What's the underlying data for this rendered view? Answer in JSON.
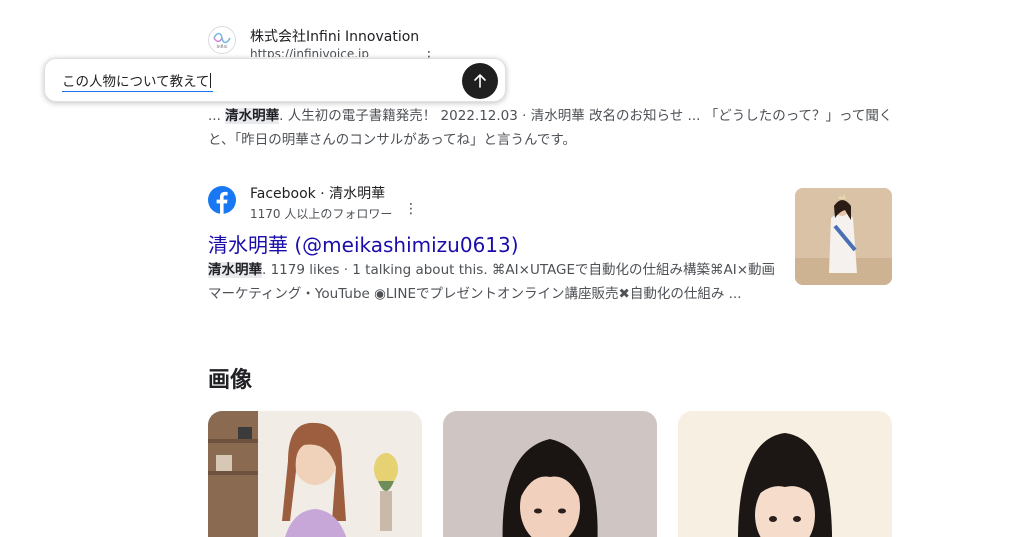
{
  "result1": {
    "site_name": "株式会社Infini Innovation",
    "site_url": "https://infinivoice.jp",
    "favicon_icon": "infini-logo-icon",
    "menu_icon": "more-vert-icon",
    "snippet_prefix": "... ",
    "snippet_highlight": "清水明華",
    "snippet_rest": ". 人生初の電子書籍発売！ 2022.12.03 · 清水明華 改名のお知らせ ... 「どうしたのって？」って聞くと、「昨日の明華さんのコンサルがあってね」と言うんです。"
  },
  "prompt": {
    "text": "この人物について教えて",
    "send_icon": "arrow-up-icon",
    "send_button_color": "#1f1f1f"
  },
  "result2": {
    "icon": "facebook-icon",
    "icon_color": "#1877f2",
    "source": "Facebook · 清水明華",
    "followers": "1170 人以上のフォロワー",
    "menu_icon": "more-vert-icon",
    "title": "清水明華 (@meikashimizu0613)",
    "title_color": "#1a0dab",
    "snippet_highlight": "清水明華",
    "snippet_rest": ". 1179 likes · 1 talking about this. ⌘AI×UTAGEで自動化の仕組み構築⌘AI×動画マーケティング・YouTube ◉LINEでプレゼントオンライン講座販売✖自動化の仕組み ..."
  },
  "images_section": {
    "heading": "画像",
    "cards": [
      {
        "name": "image-result-1"
      },
      {
        "name": "image-result-2"
      },
      {
        "name": "image-result-3"
      }
    ]
  }
}
